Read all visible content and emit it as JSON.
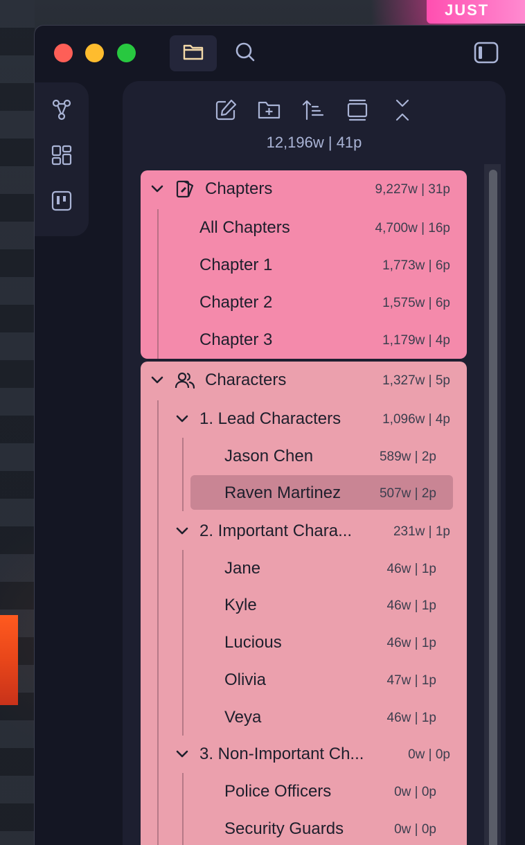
{
  "summary": "12,196w | 41p",
  "colors": {
    "chapters_bg": "#f48aab",
    "characters_bg": "#eba0ad",
    "selected_bg": "#c98594",
    "panel_bg": "#1d1f30"
  },
  "background_sign": "JUST",
  "icons": {
    "titlebar": [
      "folder-icon",
      "search-icon",
      "sidebar-toggle-icon"
    ],
    "ribbon": [
      "graph-icon",
      "dashboard-icon",
      "kanban-icon"
    ],
    "toolbar": [
      "new-note-icon",
      "new-folder-icon",
      "sort-icon",
      "collapse-view-icon",
      "collapse-all-icon"
    ]
  },
  "tree": {
    "chapters": {
      "label": "Chapters",
      "count": "9,227w | 31p",
      "items": [
        {
          "label": "All Chapters",
          "count": "4,700w | 16p"
        },
        {
          "label": "Chapter 1",
          "count": "1,773w | 6p"
        },
        {
          "label": "Chapter 2",
          "count": "1,575w | 6p"
        },
        {
          "label": "Chapter 3",
          "count": "1,179w | 4p"
        }
      ]
    },
    "characters": {
      "label": "Characters",
      "count": "1,327w | 5p",
      "folders": [
        {
          "label": "1. Lead Characters",
          "count": "1,096w | 4p",
          "items": [
            {
              "label": "Jason Chen",
              "count": "589w | 2p"
            },
            {
              "label": "Raven Martinez",
              "count": "507w | 2p",
              "selected": true
            }
          ]
        },
        {
          "label": "2. Important Chara...",
          "count": "231w | 1p",
          "items": [
            {
              "label": "Jane",
              "count": "46w | 1p"
            },
            {
              "label": "Kyle",
              "count": "46w | 1p"
            },
            {
              "label": "Lucious",
              "count": "46w | 1p"
            },
            {
              "label": "Olivia",
              "count": "47w | 1p"
            },
            {
              "label": "Veya",
              "count": "46w | 1p"
            }
          ]
        },
        {
          "label": "3. Non-Important Ch...",
          "count": "0w | 0p",
          "items": [
            {
              "label": "Police Officers",
              "count": "0w | 0p"
            },
            {
              "label": "Security Guards",
              "count": "0w | 0p"
            }
          ]
        }
      ]
    }
  }
}
